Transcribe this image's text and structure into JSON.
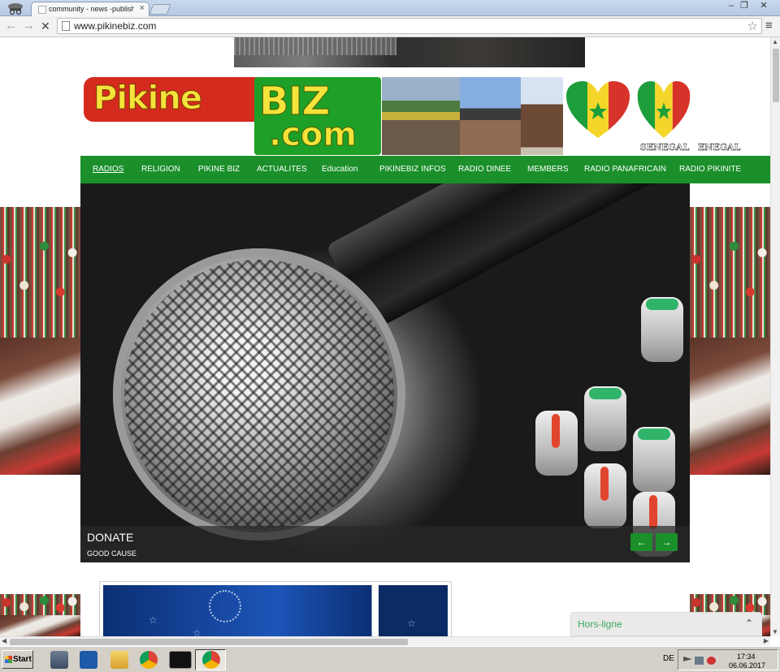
{
  "browser": {
    "tab_title": "community - news -publishing",
    "tab_close": "×",
    "url": "www.pikinebiz.com",
    "back_glyph": "←",
    "forward_glyph": "→",
    "stop_glyph": "✕",
    "star_glyph": "☆",
    "menu_glyph": "≡",
    "window_controls": {
      "minimize": "–",
      "restore": "❐",
      "close": "✕"
    }
  },
  "site": {
    "logo": {
      "part1": "Pikine",
      "part2": "BIZ",
      "part3": ".com"
    },
    "flag_labels": [
      "SENEGAL",
      "ENEGAL"
    ],
    "nav": [
      {
        "label": "RADIOS",
        "active": true
      },
      {
        "label": "RELIGION"
      },
      {
        "label": "PIKINE BIZ"
      },
      {
        "label": "ACTUALITES"
      },
      {
        "label": "Education"
      },
      {
        "label": "PIKINEBIZ INFOS"
      },
      {
        "label": "RADIO DINEE"
      },
      {
        "label": "MEMBERS"
      },
      {
        "label": "RADIO PANAFRICAIN"
      },
      {
        "label": "RADIO PIKINITE"
      }
    ],
    "slider": {
      "title": "DONATE",
      "subtitle": "GOOD CAUSE",
      "prev": "←",
      "next": "→"
    },
    "chat": {
      "status": "Hors-ligne",
      "toggle_glyph": "⌃"
    }
  },
  "taskbar": {
    "start_label": "Start",
    "language": "DE",
    "time": "17:34",
    "date": "06.06.2017"
  },
  "colors": {
    "nav_green": "#1a8f2a",
    "logo_red": "#d52b1e",
    "logo_yellow": "#f4e33a",
    "chat_status": "#3aa85c"
  }
}
